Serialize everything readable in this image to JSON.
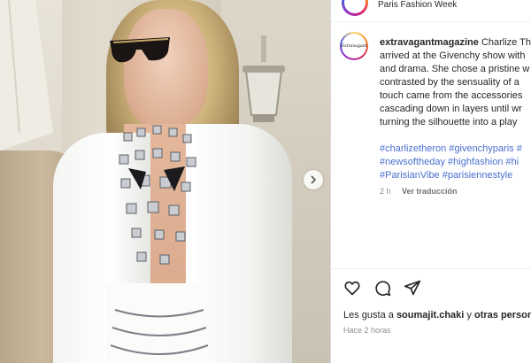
{
  "header": {
    "location": "Paris Fashion Week"
  },
  "post": {
    "username": "extravagantmagazine",
    "avatar_logo": "Extravagant",
    "caption_lines": [
      "Charlize Th",
      "arrived at the Givenchy show with",
      "and drama. She chose a pristine w",
      "contrasted by the sensuality of a",
      "touch came from the accessories",
      "cascading down in layers until wr",
      "turning the silhouette into a play"
    ],
    "hashtag_lines": [
      "#charlizetheron #givenchyparis #",
      "#newsoftheday #highfashion #hi",
      "#ParisianVibe #parisiennestyle"
    ],
    "caption_age": "2 h",
    "translate_label": "Ver traducción",
    "likes_prefix": "Les gusta a",
    "likes_user": "soumajit.chaki",
    "likes_suffix": "y",
    "likes_others": "otras person",
    "post_time": "Hace 2 horas"
  },
  "icons": {
    "like": "heart-icon",
    "comment": "comment-icon",
    "share": "share-icon",
    "next": "chevron-right-icon"
  }
}
